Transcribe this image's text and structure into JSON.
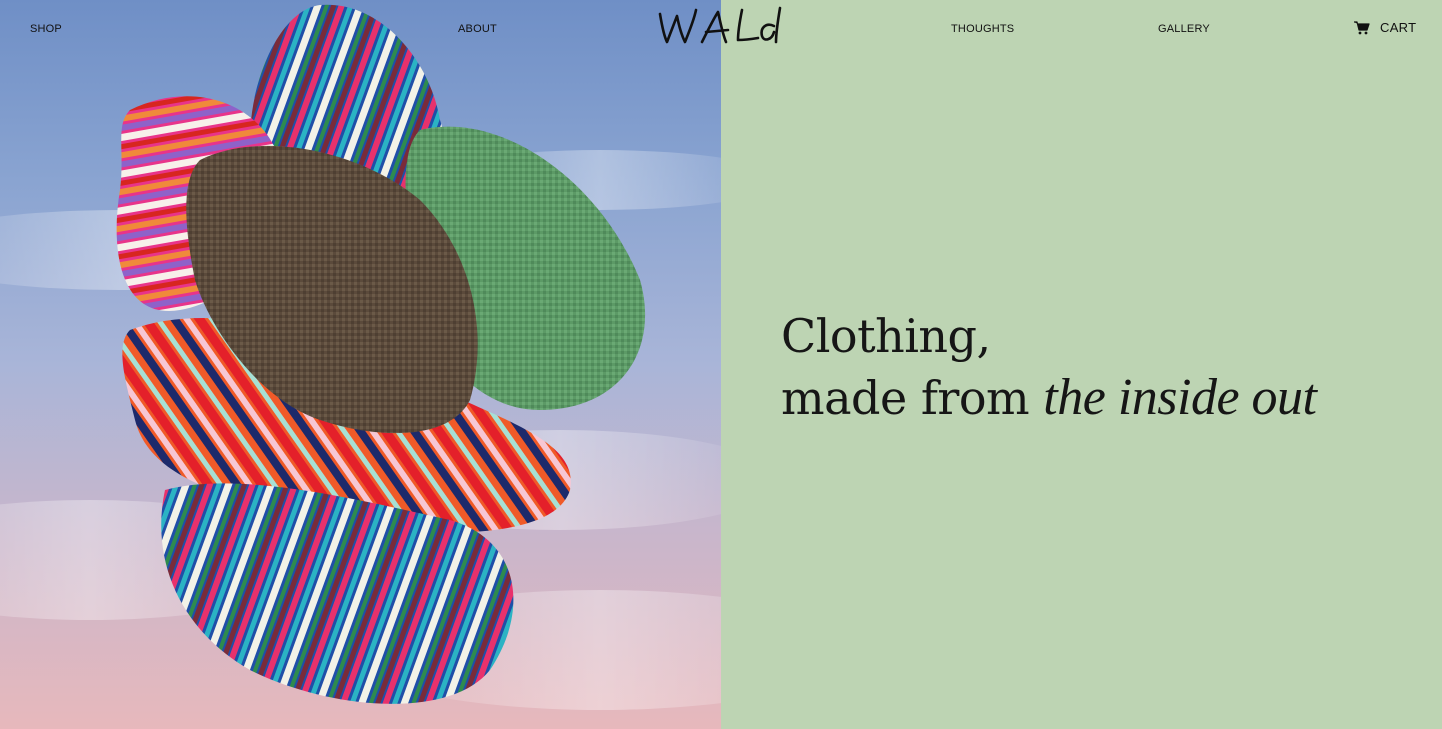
{
  "nav": {
    "shop_label": "SHOP",
    "about_label": "ABOUT",
    "thoughts_label": "THOUGHTS",
    "gallery_label": "GALLERY",
    "cart_label": "CART",
    "logo_text": "WALd"
  },
  "hero": {
    "headline_line1": "Clothing,",
    "headline_line2_prefix": "made from ",
    "headline_line2_emphasis": "the inside out"
  },
  "colors": {
    "right_panel_bg": "#bdd4b3",
    "text": "#161616",
    "sky_top": "#6f8fc6",
    "sky_bottom": "#e7b8bc"
  },
  "icons": {
    "cart": "shopping-cart-icon"
  }
}
